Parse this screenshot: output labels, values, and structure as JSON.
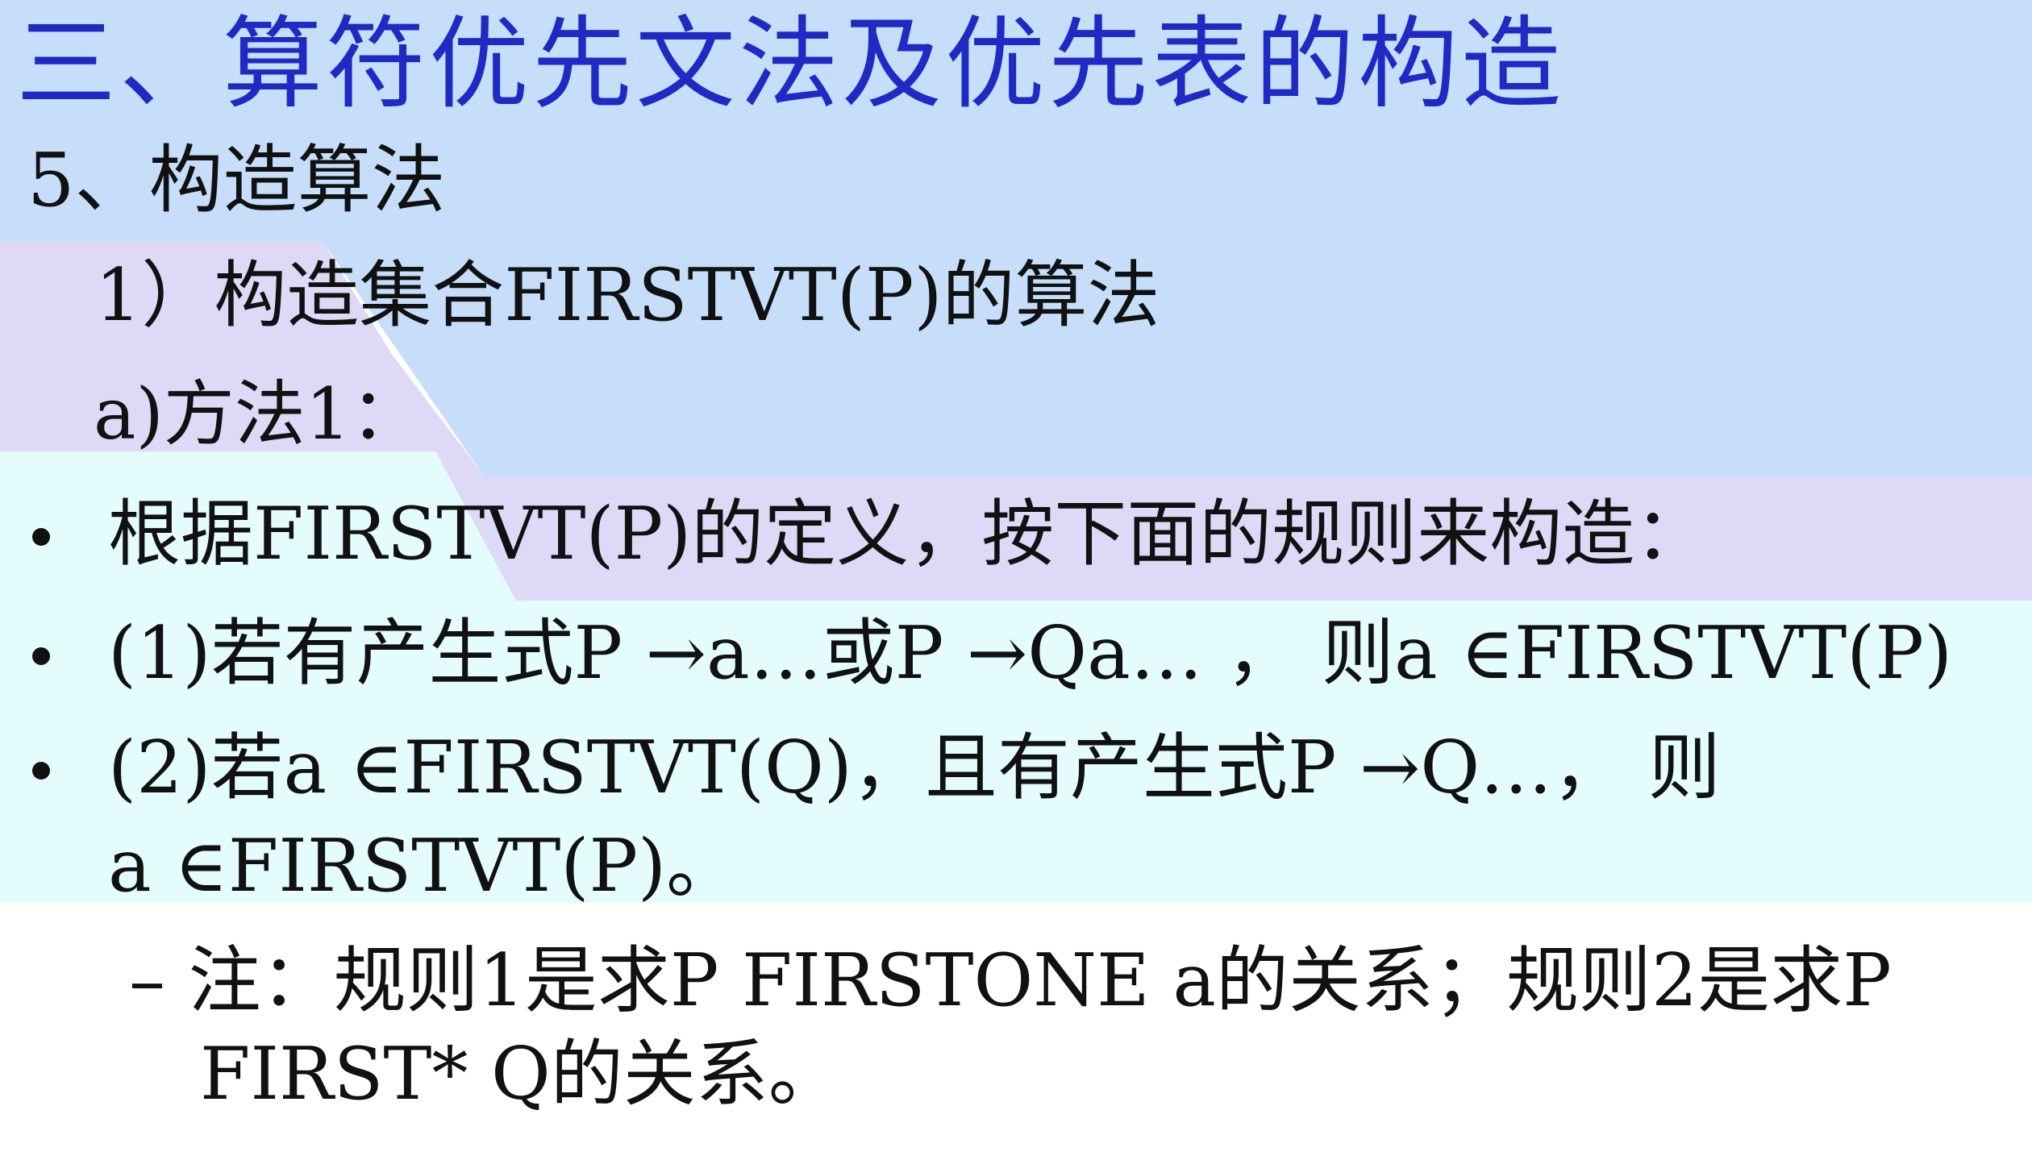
{
  "title": "三、算符优先文法及优先表的构造",
  "section": "5、构造算法",
  "subsection": "1）构造集合FIRSTVT(P)的算法",
  "method": "a)方法1：",
  "bullets": [
    "根据FIRSTVT(P)的定义，按下面的规则来构造：",
    "(1)若有产生式P →a…或P →Qa… ， 则a ∈FIRSTVT(P)",
    "(2)若a ∈FIRSTVT(Q)，且有产生式P →Q…， 则",
    "a ∈FIRSTVT(P)。"
  ],
  "note": "– 注：规则1是求P  FIRSTONE a的关系；规则2是求P",
  "note_cont": "FIRST* Q的关系。",
  "colors": {
    "title": "#1f2ac4",
    "bg_blue": "#c6defa",
    "bg_lavender": "#ddd9f6",
    "bg_cyan": "#e4fcfc"
  }
}
